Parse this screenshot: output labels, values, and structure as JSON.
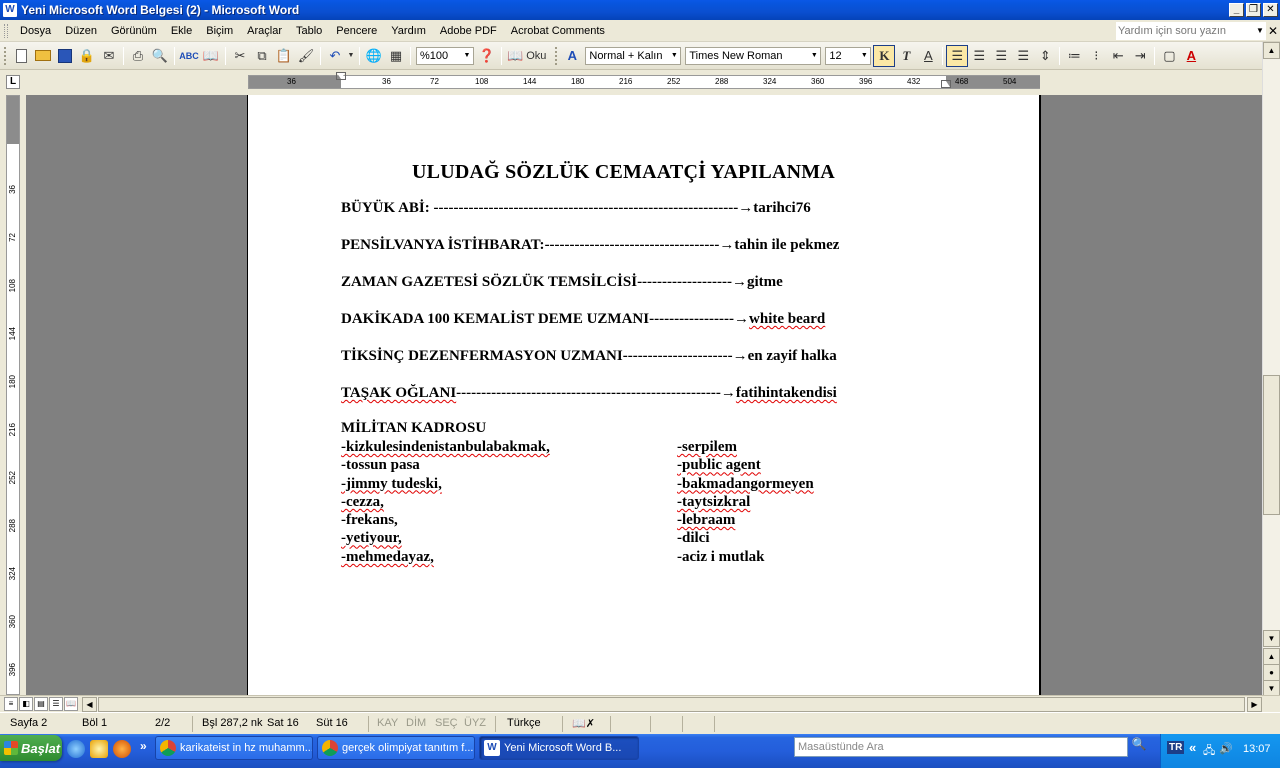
{
  "window": {
    "title": "Yeni Microsoft Word Belgesi (2) - Microsoft Word"
  },
  "menu": {
    "items": [
      "Dosya",
      "Düzen",
      "Görünüm",
      "Ekle",
      "Biçim",
      "Araçlar",
      "Tablo",
      "Pencere",
      "Yardım",
      "Adobe PDF",
      "Acrobat Comments"
    ],
    "help_placeholder": "Yardım için soru yazın"
  },
  "toolbar": {
    "zoom": "%100",
    "read_label": "Oku",
    "style": "Normal + Kalın",
    "font": "Times New Roman",
    "size": "12"
  },
  "ruler": {
    "h_ticks": [
      "36",
      "36",
      "72",
      "108",
      "144",
      "180",
      "216",
      "252",
      "288",
      "324",
      "360",
      "396",
      "432",
      "468",
      "504"
    ],
    "v_ticks": [
      "36",
      "72",
      "108",
      "144",
      "180",
      "216",
      "252",
      "288",
      "324",
      "360",
      "396"
    ]
  },
  "document": {
    "title": "ULUDAĞ SÖZLÜK CEMAATÇİ YAPILANMA",
    "lines": [
      {
        "label": "BÜYÜK ABİ: ",
        "dashes": "-------------------------------------------------------------",
        "arrow": "→",
        "value": "tarihci76"
      },
      {
        "label": "PENSİLVANYA İSTİHBARAT:",
        "dashes": "-----------------------------------",
        "arrow": "→",
        "value": "tahin ile pekmez"
      },
      {
        "label": "ZAMAN GAZETESİ SÖZLÜK TEMSİLCİSİ",
        "dashes": "-------------------",
        "arrow": "→",
        "value": "gitme"
      },
      {
        "label": "DAKİKADA 100 KEMALİST DEME UZMANI",
        "dashes": "-----------------",
        "arrow": "→",
        "value": "white beard"
      },
      {
        "label": "TİKSİNÇ DEZENFERMASYON UZMANI",
        "dashes": "----------------------",
        "arrow": "→",
        "value": "en zayif halka"
      },
      {
        "label": "TAŞAK OĞLANI",
        "dashes": "-----------------------------------------------------",
        "arrow": "→",
        "value": "fatihintakendisi"
      }
    ],
    "militan_heading": "MİLİTAN KADROSU",
    "roster_left": [
      "-kizkulesindenistanbulabakmak,",
      "-tossun pasa",
      "-jimmy tudeski,",
      "-cezza,",
      "-frekans,",
      "-yetiyour,",
      "-mehmedayaz,"
    ],
    "roster_right": [
      "-serpilem",
      "-public agent",
      "-bakmadangormeyen",
      "-taytsizkral",
      "-lebraam",
      "-dilci",
      "-aciz i mutlak"
    ]
  },
  "status": {
    "page": "Sayfa  2",
    "section": "Böl  1",
    "pages": "2/2",
    "position": "Bşl  287,2 nk",
    "line": "Sat  16",
    "column": "Süt  16",
    "rec": "KAY",
    "trk": "DİM",
    "ext": "SEÇ",
    "ovr": "ÜYZ",
    "language": "Türkçe"
  },
  "taskbar": {
    "start_label": "Başlat",
    "tasks": [
      {
        "label": "karikateist in hz muhamm...",
        "color": "#db4437"
      },
      {
        "label": "gerçek olimpiyat tanıtım f...",
        "color": "#db4437"
      },
      {
        "label": "Yeni Microsoft Word B...",
        "color": "#1e4db7"
      }
    ],
    "search_placeholder": "Masaüstünde Ara",
    "lang": "TR",
    "clock": "13:07"
  }
}
